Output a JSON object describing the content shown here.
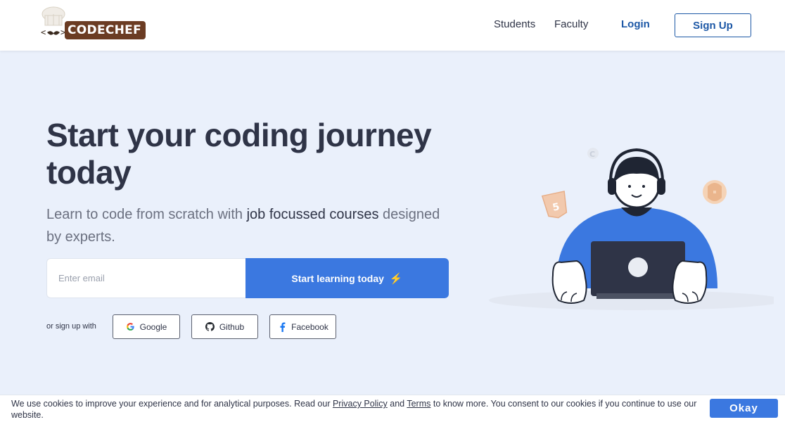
{
  "header": {
    "logo_text": "CODECHEF",
    "nav": {
      "students": "Students",
      "faculty": "Faculty",
      "login": "Login",
      "signup": "Sign Up"
    }
  },
  "hero": {
    "title": "Start your coding journey today",
    "subtitle_part1": "Learn to code from scratch with ",
    "subtitle_highlight": "job focussed courses",
    "subtitle_part2": " designed by experts.",
    "email_placeholder": "Enter email",
    "email_value": "",
    "cta_label": "Start learning today",
    "cta_icon": "lightning-icon"
  },
  "social": {
    "label": "or sign up with",
    "google": "Google",
    "github": "Github",
    "facebook": "Facebook"
  },
  "cookie": {
    "text_part1": "We use cookies to improve your experience and for analytical purposes. Read our ",
    "privacy_link": "Privacy Policy",
    "text_and": " and ",
    "terms_link": "Terms",
    "text_part2": " to know more. You consent to our cookies if you continue to use our website.",
    "okay": "Okay"
  },
  "colors": {
    "primary": "#3b78e0",
    "brand_dark": "#1d58a6",
    "background": "#eaf0fb",
    "text": "#2f3447"
  }
}
